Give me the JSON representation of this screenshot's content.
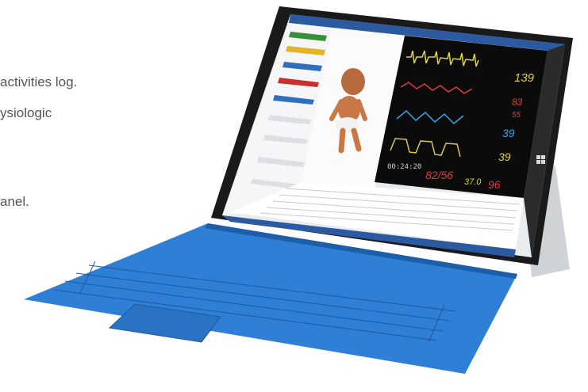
{
  "background_text": {
    "line1": "activities log.",
    "line2": "ysiologic",
    "line3": "anel."
  },
  "monitor": {
    "timer": "00:24:20",
    "vitals": {
      "hr": "139",
      "spo2": "83",
      "resp": "55",
      "etco2": "39",
      "temp_right": "39",
      "bp": "82/56",
      "temp": "37.0",
      "pulse": "96"
    }
  },
  "colors": {
    "keyboard": "#2f7fd6",
    "monitor_bg": "#0b0b0b",
    "ecg": "#e0d43a",
    "pleth": "#e23c3c",
    "resp": "#3fa3e8",
    "etco2": "#d9c94a"
  },
  "icons": {
    "avatar": "baby-mannequin",
    "windows_logo": "windows-logo",
    "touchpad": "touchpad"
  }
}
